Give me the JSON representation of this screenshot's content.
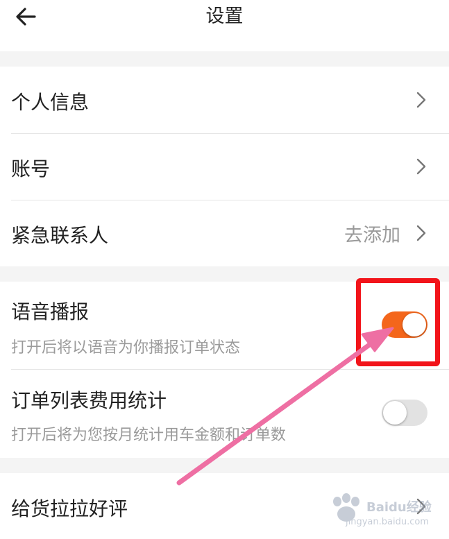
{
  "header": {
    "title": "设置",
    "back_icon": "arrow-left-icon"
  },
  "group1": [
    {
      "label": "个人信息",
      "icon": "chevron-right-icon"
    },
    {
      "label": "账号",
      "icon": "chevron-right-icon"
    },
    {
      "label": "紧急联系人",
      "value": "去添加",
      "icon": "chevron-right-icon"
    }
  ],
  "group2": [
    {
      "label": "语音播报",
      "description": "打开后将以语音为你播报订单状态",
      "toggle": "on"
    },
    {
      "label": "订单列表费用统计",
      "description": "打开后将为您按月统计用车金额和订单数",
      "toggle": "off"
    }
  ],
  "group3": [
    {
      "label": "给货拉拉好评",
      "icon": "chevron-right-icon"
    }
  ],
  "colors": {
    "toggle_on": "#f4661b",
    "toggle_off": "#e2e2e2",
    "highlight": "#f2141a",
    "arrow": "#ee6fa3"
  },
  "watermark": {
    "brand": "Baidu经验",
    "url": "jingyan.baidu.com"
  }
}
